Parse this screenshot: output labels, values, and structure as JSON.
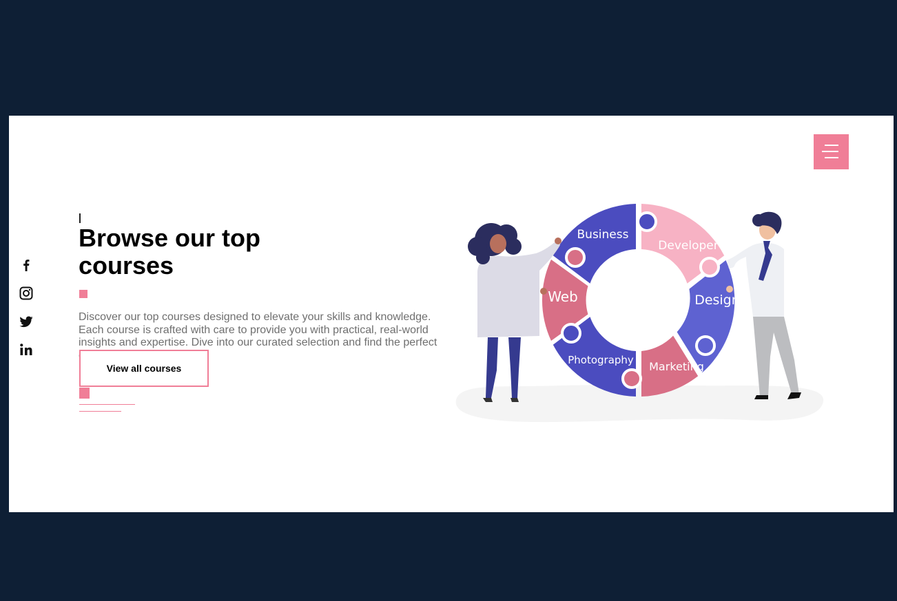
{
  "hero": {
    "title": "Browse our top courses",
    "description": "Discover our top courses designed to elevate your skills and knowledge. Each course is crafted with care to provide you with practical, real-world insights and expertise. Dive into our curated selection and find the perfect course.",
    "cta_label": "View all courses"
  },
  "social": [
    {
      "icon": "facebook-icon"
    },
    {
      "icon": "instagram-icon"
    },
    {
      "icon": "twitter-icon"
    },
    {
      "icon": "linkedin-icon"
    }
  ],
  "menu": {
    "icon": "menu-icon"
  },
  "illustration": {
    "segments": [
      "Business",
      "Developer",
      "Design",
      "Marketing",
      "Photography",
      "Web"
    ]
  },
  "colors": {
    "background": "#0e1f35",
    "accent": "#f07e97",
    "purple": "#4d4fbf",
    "pink_light": "#f7b2c4",
    "rose": "#d86f86",
    "blue_violet": "#5e62d1"
  }
}
